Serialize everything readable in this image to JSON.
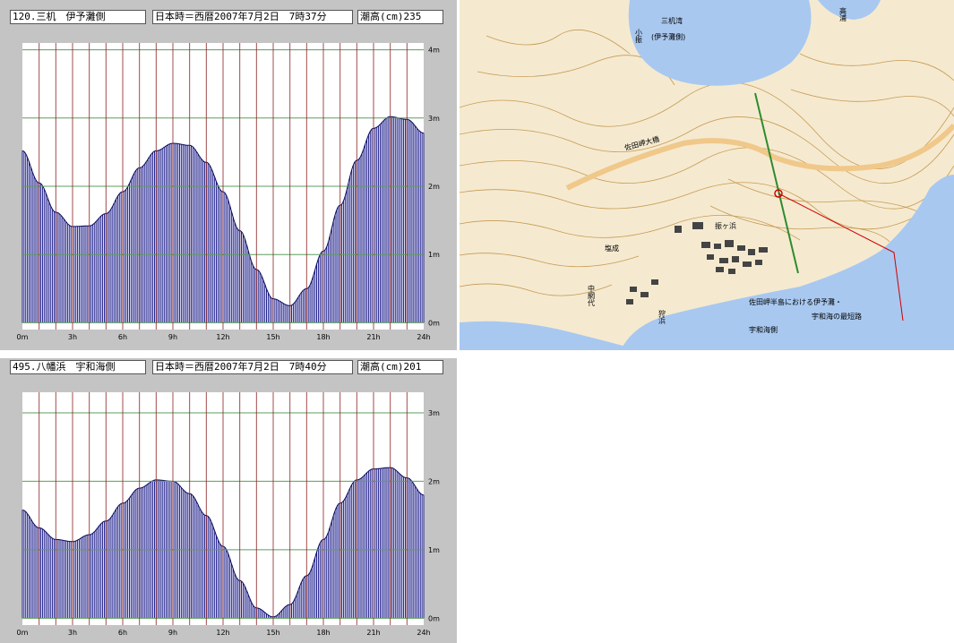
{
  "charts": [
    {
      "station": "120.三机　伊予灘側",
      "time": "日本時＝西暦2007年7月2日　7時37分",
      "height": "潮高(cm)235"
    },
    {
      "station": "495.八幡浜　宇和海側",
      "time": "日本時＝西暦2007年7月2日　7時40分",
      "height": "潮高(cm)201"
    }
  ],
  "map": {
    "labels": {
      "bay": "三机湾",
      "bay_sub": "(伊予灘側)",
      "kofuri": "小振",
      "takaura": "高浦",
      "shiojo": "塩成",
      "furikohama": "振ヶ浜",
      "nakaamishiro": "中網代",
      "karihama": "狩浜",
      "road": "佐田岬大橋",
      "note_line1": "佐田岬半島における伊予灘・",
      "note_line2": "宇和海の最短路",
      "uwakai": "宇和海側"
    },
    "colors": {
      "sea": "#a8c8f0",
      "land": "#f5ead0",
      "route": "#2e8b2e",
      "pointer": "#d00000",
      "road": "#f0c88a"
    }
  },
  "chart_data": [
    {
      "type": "area",
      "title": "120.三机　伊予灘側",
      "x_unit": "h",
      "y_unit": "m",
      "xlim": [
        0,
        24
      ],
      "ylim": [
        -0.1,
        4.1
      ],
      "xticks": [
        "0m",
        "3h",
        "6h",
        "9h",
        "12h",
        "15h",
        "18h",
        "21h",
        "24h"
      ],
      "yticks": [
        "0m",
        "1m",
        "2m",
        "3m",
        "4m"
      ],
      "fill_color": "#1a1a8a",
      "gridline_color": "#5e9e5e",
      "hour_line_color": "#8a2020",
      "x": [
        0,
        1,
        2,
        3,
        4,
        5,
        6,
        7,
        8,
        9,
        10,
        11,
        12,
        13,
        14,
        15,
        16,
        17,
        18,
        19,
        20,
        21,
        22,
        23,
        24
      ],
      "values": [
        2.52,
        2.05,
        1.62,
        1.41,
        1.42,
        1.6,
        1.92,
        2.27,
        2.52,
        2.63,
        2.6,
        2.35,
        1.92,
        1.35,
        0.78,
        0.35,
        0.25,
        0.5,
        1.05,
        1.72,
        2.38,
        2.85,
        3.02,
        2.98,
        2.78
      ]
    },
    {
      "type": "area",
      "title": "495.八幡浜　宇和海側",
      "x_unit": "h",
      "y_unit": "m",
      "xlim": [
        0,
        24
      ],
      "ylim": [
        -0.1,
        3.3
      ],
      "xticks": [
        "0m",
        "3h",
        "6h",
        "9h",
        "12h",
        "15h",
        "18h",
        "21h",
        "24h"
      ],
      "yticks": [
        "0m",
        "1m",
        "2m",
        "3m"
      ],
      "fill_color": "#1a1a8a",
      "gridline_color": "#5e9e5e",
      "hour_line_color": "#8a2020",
      "x": [
        0,
        1,
        2,
        3,
        4,
        5,
        6,
        7,
        8,
        9,
        10,
        11,
        12,
        13,
        14,
        15,
        16,
        17,
        18,
        19,
        20,
        21,
        22,
        23,
        24
      ],
      "values": [
        1.58,
        1.32,
        1.15,
        1.12,
        1.22,
        1.42,
        1.68,
        1.9,
        2.02,
        2.0,
        1.82,
        1.5,
        1.05,
        0.55,
        0.15,
        0.02,
        0.2,
        0.62,
        1.15,
        1.68,
        2.02,
        2.18,
        2.2,
        2.05,
        1.8
      ]
    }
  ]
}
